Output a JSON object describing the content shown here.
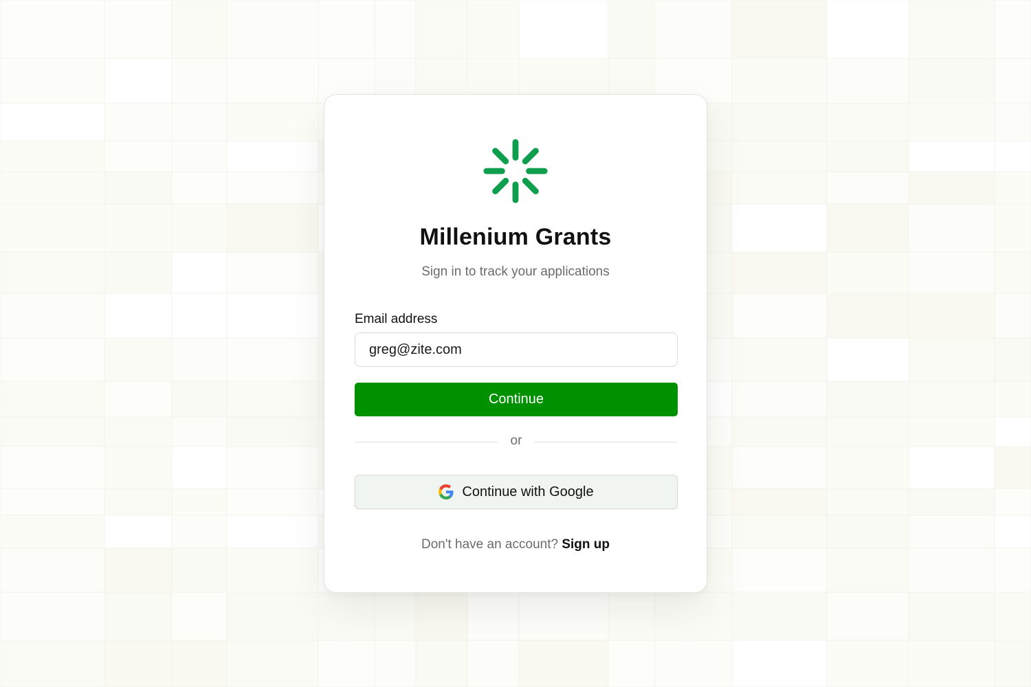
{
  "app": {
    "logo_icon": "green-asterisk-logo",
    "title": "Millenium Grants",
    "subtitle": "Sign in to track your applications"
  },
  "form": {
    "email_label": "Email address",
    "email_value": "greg@zite.com",
    "continue_label": "Continue",
    "divider_text": "or",
    "google_label": "Continue with Google",
    "google_icon": "google-g-icon"
  },
  "footer": {
    "prompt": "Don't have an account?",
    "signup_label": "Sign up"
  },
  "colors": {
    "brand_green": "#009100",
    "logo_green": "#0f9d4e",
    "background": "#fdfdfa"
  }
}
